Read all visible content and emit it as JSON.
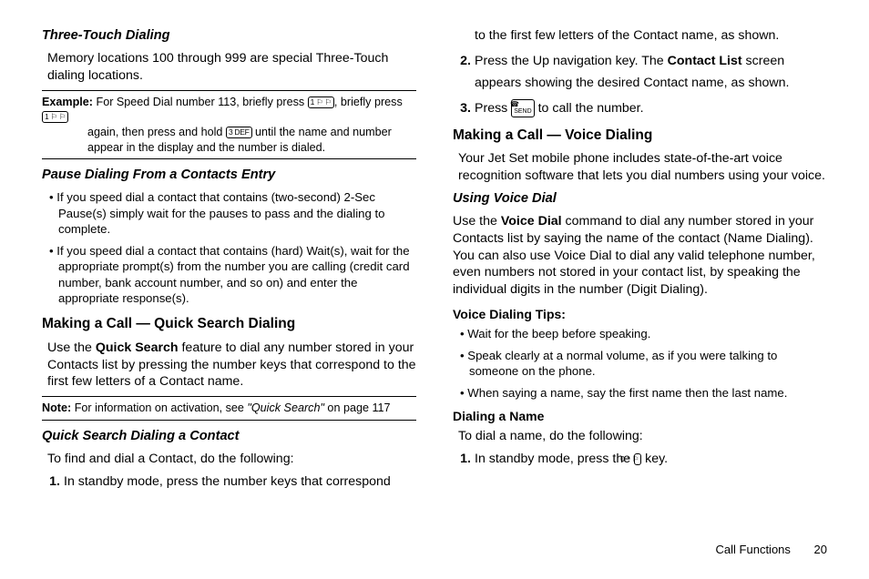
{
  "col1": {
    "h_three_touch": "Three-Touch Dialing",
    "p_three_touch": "Memory locations 100 through 999 are special Three-Touch dialing locations.",
    "example_label": "Example:",
    "example_line1a": "For Speed Dial number 113, briefly press ",
    "example_line1b": ", briefly press ",
    "example_line2a": "again, then press and hold ",
    "example_line2b": " until the name and number appear in the display and the number is dialed.",
    "h_pause": "Pause Dialing From a Contacts Entry",
    "bul_pause1": "If you speed dial a contact that contains (two-second) 2-Sec Pause(s) simply wait for the pauses to pass and the dialing to complete.",
    "bul_pause2": "If you speed dial a contact that contains (hard) Wait(s), wait for the appropriate prompt(s) from the number you are calling (credit card number, bank account number, and so on) and enter the appropriate response(s).",
    "h_quick": "Making a Call — Quick Search Dialing",
    "quick_p1a": "Use the ",
    "quick_p1_bold": "Quick Search",
    "quick_p1b": " feature to dial any number stored in your Contacts list by pressing the number keys that correspond to the first few letters of a Contact name.",
    "note_label": "Note:",
    "note_a": "For information on activation, see ",
    "note_i": "\"Quick Search\"",
    "note_b": " on page 117",
    "h_qsdc": "Quick Search Dialing a Contact",
    "qsdc_p": "To find and dial a Contact, do the following:",
    "step1": "In standby mode, press the number keys that correspond"
  },
  "col2": {
    "p_cont": "to the first few letters of the Contact name, as shown.",
    "step2a": "Press the Up navigation key. The ",
    "step2_bold": "Contact List",
    "step2b": " screen appears showing the desired Contact name, as shown.",
    "step3a": "Press ",
    "step3b": " to call the number.",
    "h_voice": "Making a Call — Voice Dialing",
    "voice_p": "Your Jet Set mobile phone includes state-of-the-art voice recognition software that lets you dial numbers using your voice.",
    "h_uvd": "Using Voice Dial",
    "uvd_p1a": "Use the ",
    "uvd_p1_bold": "Voice Dial",
    "uvd_p1b": " command to dial any number stored in your Contacts list by saying the name of the contact (Name Dialing). You can also use Voice Dial to dial any valid telephone number, even numbers not stored in your contact list, by speaking the individual digits in the number (Digit Dialing).",
    "h_tips": "Voice Dialing Tips:",
    "tip1": "Wait for the beep before speaking.",
    "tip2": "Speak clearly at a normal volume, as if you were talking to someone on the phone.",
    "tip3": " When saying a name, say the first name then the last name.",
    "h_dname": "Dialing a Name",
    "dname_p": "To dial a name, do the following:",
    "dname_step1a": "In standby mode, press the ",
    "dname_step1b": " key."
  },
  "keys": {
    "one": "1 ⚐ ⚐",
    "three": "3 DEF",
    "zero": "0 ⁺ ⚐",
    "send": "SEND"
  },
  "footer": {
    "section": "Call Functions",
    "page": "20"
  }
}
